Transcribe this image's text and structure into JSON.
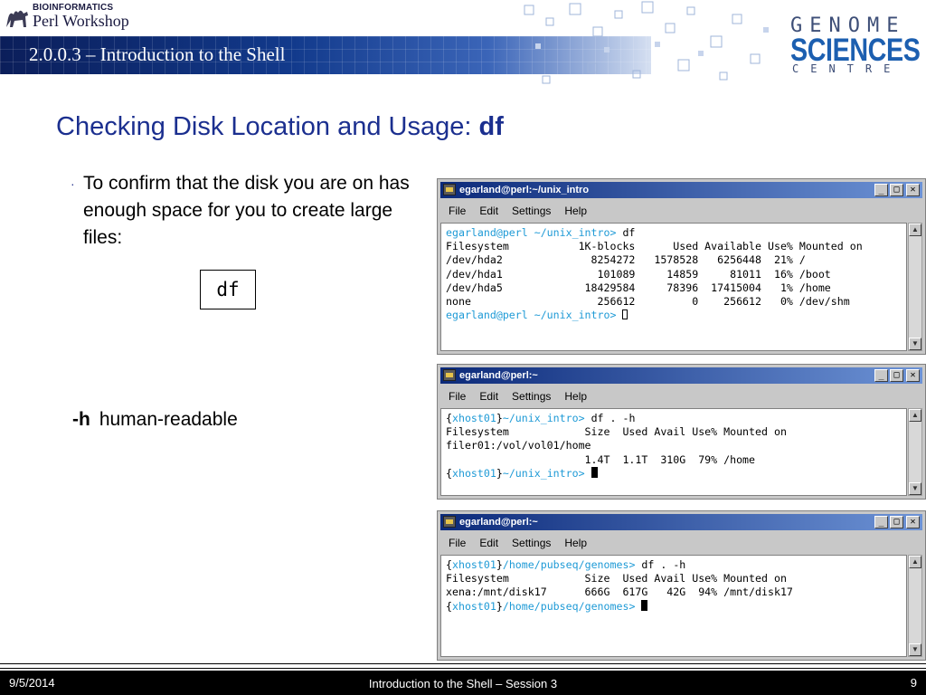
{
  "header": {
    "logo_line1": "BIOINFORMATICS",
    "logo_line2": "Perl Workshop",
    "deck_title": "2.0.0.3 – Introduction to the Shell",
    "gsc_line1": "GENOME",
    "gsc_line2": "SCIENCES",
    "gsc_line3": "CENTRE"
  },
  "slide": {
    "title_prefix": "Checking Disk Location and Usage: ",
    "title_command": "df",
    "bullet_dot": "·",
    "bullet_text": "To confirm that the disk you are on has enough space for you to create large files:",
    "command_box": "df",
    "option_flag": "-h",
    "option_desc": "human-readable"
  },
  "terminals": [
    {
      "title": "egarland@perl:~/unix_intro",
      "menu": [
        "File",
        "Edit",
        "Settings",
        "Help"
      ],
      "lines": [
        {
          "prompt": "egarland@perl ~/unix_intro>",
          "cmd": " df"
        },
        {
          "text": "Filesystem           1K-blocks      Used Available Use% Mounted on"
        },
        {
          "text": "/dev/hda2              8254272   1578528   6256448  21% /"
        },
        {
          "text": "/dev/hda1               101089     14859     81011  16% /boot"
        },
        {
          "text": "/dev/hda5             18429584     78396  17415004   1% /home"
        },
        {
          "text": "none                    256612         0    256612   0% /dev/shm"
        },
        {
          "prompt": "egarland@perl ~/unix_intro>",
          "cmd": " "
        }
      ]
    },
    {
      "title": "egarland@perl:~",
      "menu": [
        "File",
        "Edit",
        "Settings",
        "Help"
      ],
      "lines": [
        {
          "open": "{",
          "host": "xhost01",
          "close": "}",
          "path": "~/unix_intro>",
          "cmd": " df . -h"
        },
        {
          "text": "Filesystem            Size  Used Avail Use% Mounted on"
        },
        {
          "text": "filer01:/vol/vol01/home"
        },
        {
          "text": "                      1.4T  1.1T  310G  79% /home"
        },
        {
          "open": "{",
          "host": "xhost01",
          "close": "}",
          "path": "~/unix_intro>",
          "cmd": " "
        }
      ]
    },
    {
      "title": "egarland@perl:~",
      "menu": [
        "File",
        "Edit",
        "Settings",
        "Help"
      ],
      "lines": [
        {
          "open": "{",
          "host": "xhost01",
          "close": "}",
          "path": "/home/pubseq/genomes>",
          "cmd": " df . -h"
        },
        {
          "text": "Filesystem            Size  Used Avail Use% Mounted on"
        },
        {
          "text": "xena:/mnt/disk17      666G  617G   42G  94% /mnt/disk17"
        },
        {
          "open": "{",
          "host": "xhost01",
          "close": "}",
          "path": "/home/pubseq/genomes>",
          "cmd": " "
        }
      ]
    }
  ],
  "window_buttons": {
    "minimize": "_",
    "maximize": "□",
    "close": "✕"
  },
  "footer": {
    "date": "9/5/2014",
    "center": "Introduction to the Shell – Session 3",
    "page": "9"
  },
  "colors": {
    "title_blue": "#1b2f8f",
    "prompt_cyan": "#1e9ad6",
    "window_title_start": "#0c2a7a",
    "window_title_end": "#6d93d6"
  },
  "icons": [
    "camel-logo-icon",
    "terminal-app-icon",
    "scroll-up-arrow-icon",
    "scroll-down-arrow-icon"
  ]
}
